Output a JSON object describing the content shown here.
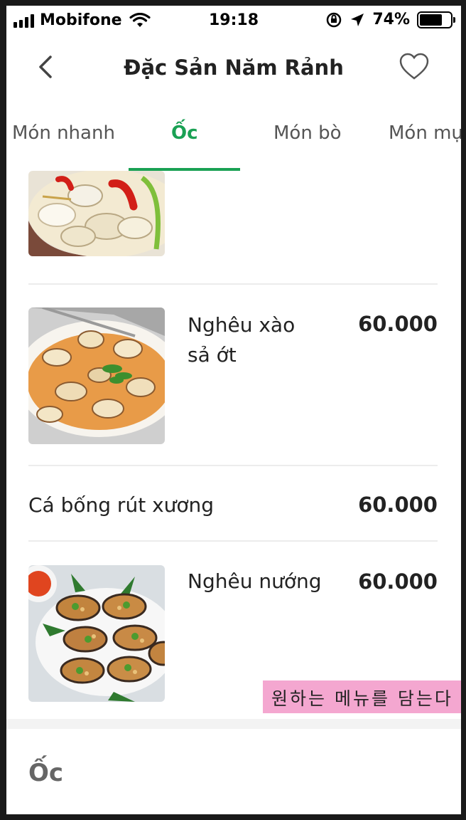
{
  "status_bar": {
    "carrier": "Mobifone",
    "time": "19:18",
    "battery": "74%",
    "battery_level": 0.74,
    "icons": [
      "signal-icon",
      "wifi-icon",
      "rotation-lock-icon",
      "location-arrow-icon",
      "battery-icon"
    ]
  },
  "nav": {
    "title": "Đặc Sản Năm Rảnh",
    "back_icon": "chevron-left-icon",
    "favorite_icon": "heart-outline-icon"
  },
  "tabs": [
    {
      "label": "Món nhanh",
      "active": false
    },
    {
      "label": "Ốc",
      "active": true
    },
    {
      "label": "Món bò",
      "active": false
    },
    {
      "label": "Món mự",
      "active": false
    }
  ],
  "colors": {
    "accent": "#1aa154",
    "text": "#222222",
    "divider": "#ececec",
    "stamp": "#f4a7d0"
  },
  "menu_items": [
    {
      "name": "Nghêu xào\nsả ớt",
      "price": "60.000",
      "has_image": true
    },
    {
      "name": "Cá bống rút xương",
      "price": "60.000",
      "has_image": false
    },
    {
      "name": "Nghêu nướng",
      "price": "60.000",
      "has_image": true
    }
  ],
  "overlay_caption": "원하는 메뉴를 담는다",
  "section": {
    "title": "Ốc"
  }
}
